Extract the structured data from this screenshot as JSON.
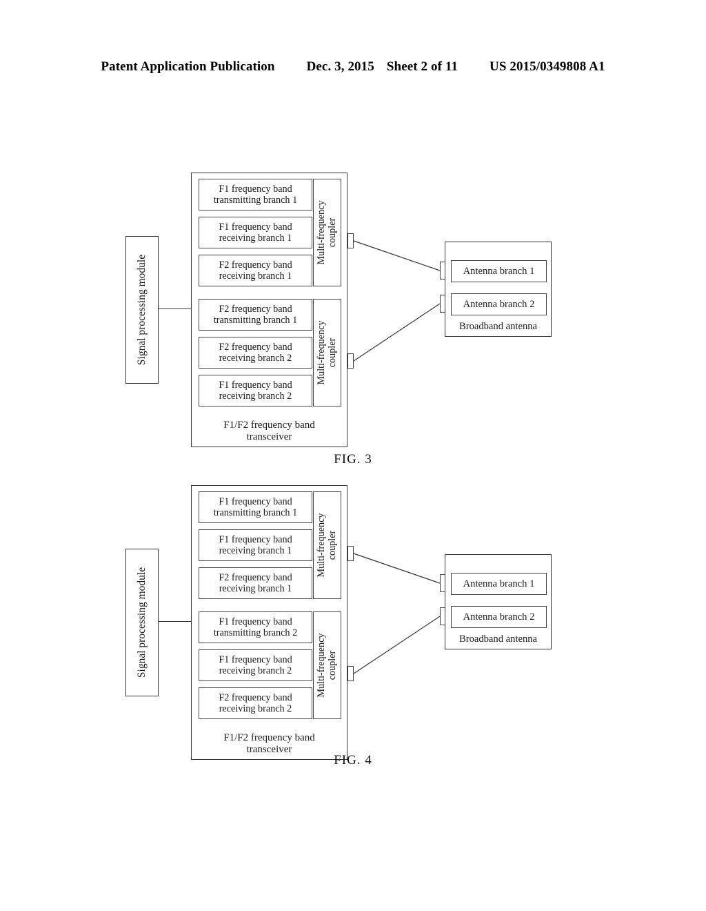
{
  "header": {
    "publication": "Patent Application Publication",
    "date": "Dec. 3, 2015",
    "sheet": "Sheet 2 of 11",
    "number": "US 2015/0349808 A1"
  },
  "common": {
    "signal_processing_module": "Signal processing module",
    "coupler_label_line1": "Multi-frequency",
    "coupler_label_line2": "coupler",
    "transceiver_caption_line1": "F1/F2 frequency band",
    "transceiver_caption_line2": "transceiver",
    "antenna": {
      "branch_1": "Antenna branch 1",
      "branch_2": "Antenna branch 2",
      "caption": "Broadband antenna"
    }
  },
  "figures": [
    {
      "caption": "FIG. 3",
      "groups": [
        {
          "name": "upper-coupler-group",
          "branches": [
            {
              "line1": "F1 frequency band",
              "line2": "transmitting branch 1"
            },
            {
              "line1": "F1 frequency band",
              "line2": "receiving branch 1"
            },
            {
              "line1": "F2 frequency band",
              "line2": "receiving branch 1"
            }
          ]
        },
        {
          "name": "lower-coupler-group",
          "branches": [
            {
              "line1": "F2 frequency band",
              "line2": "transmitting branch 1"
            },
            {
              "line1": "F2 frequency band",
              "line2": "receiving branch 2"
            },
            {
              "line1": "F1 frequency band",
              "line2": "receiving branch 2"
            }
          ]
        }
      ]
    },
    {
      "caption": "FIG. 4",
      "groups": [
        {
          "name": "upper-coupler-group",
          "branches": [
            {
              "line1": "F1 frequency band",
              "line2": "transmitting branch 1"
            },
            {
              "line1": "F1 frequency band",
              "line2": "receiving branch 1"
            },
            {
              "line1": "F2 frequency band",
              "line2": "receiving branch 1"
            }
          ]
        },
        {
          "name": "lower-coupler-group",
          "branches": [
            {
              "line1": "F1 frequency band",
              "line2": "transmitting branch 2"
            },
            {
              "line1": "F1 frequency band",
              "line2": "receiving branch 2"
            },
            {
              "line1": "F2 frequency band",
              "line2": "receiving branch 2"
            }
          ]
        }
      ]
    }
  ]
}
